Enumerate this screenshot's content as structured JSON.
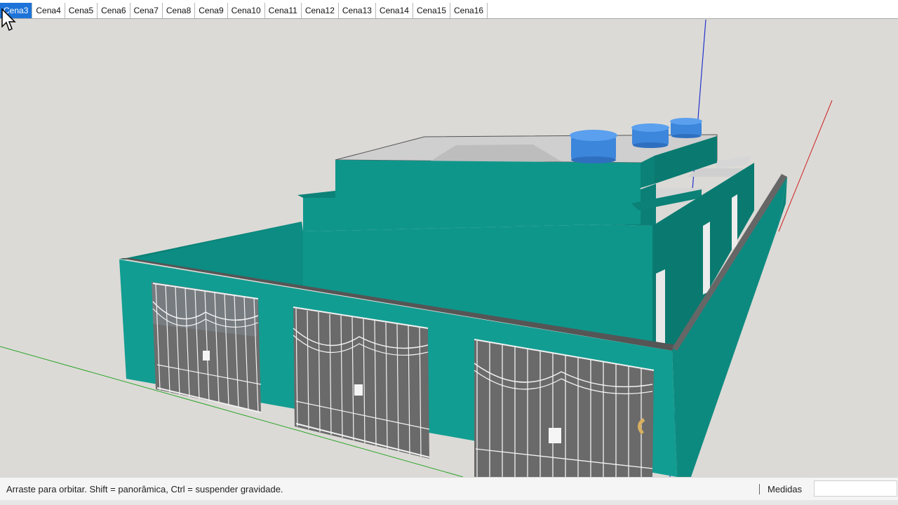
{
  "scene_tabs": [
    "Cena3",
    "Cena4",
    "Cena5",
    "Cena6",
    "Cena7",
    "Cena8",
    "Cena9",
    "Cena10",
    "Cena11",
    "Cena12",
    "Cena13",
    "Cena14",
    "Cena15",
    "Cena16"
  ],
  "active_tab_index": 0,
  "status_bar": {
    "hint": "Arraste para orbitar. Shift = panorâmica, Ctrl = suspender gravidade.",
    "measurements_label": "Medidas",
    "measurements_value": ""
  },
  "viewport": {
    "model": "teal house with three gated garages and three water tanks",
    "cursor_icon": "arrow-cursor-icon"
  },
  "colors": {
    "tab_active": "#1e73d8",
    "wall_teal": "#0f9a8f",
    "wall_dark": "#0a7a70",
    "background": "#dcdad6",
    "tank_blue": "#3c86dc",
    "axis_red": "#cc2222",
    "axis_green": "#22aa22",
    "axis_blue": "#2233cc"
  }
}
